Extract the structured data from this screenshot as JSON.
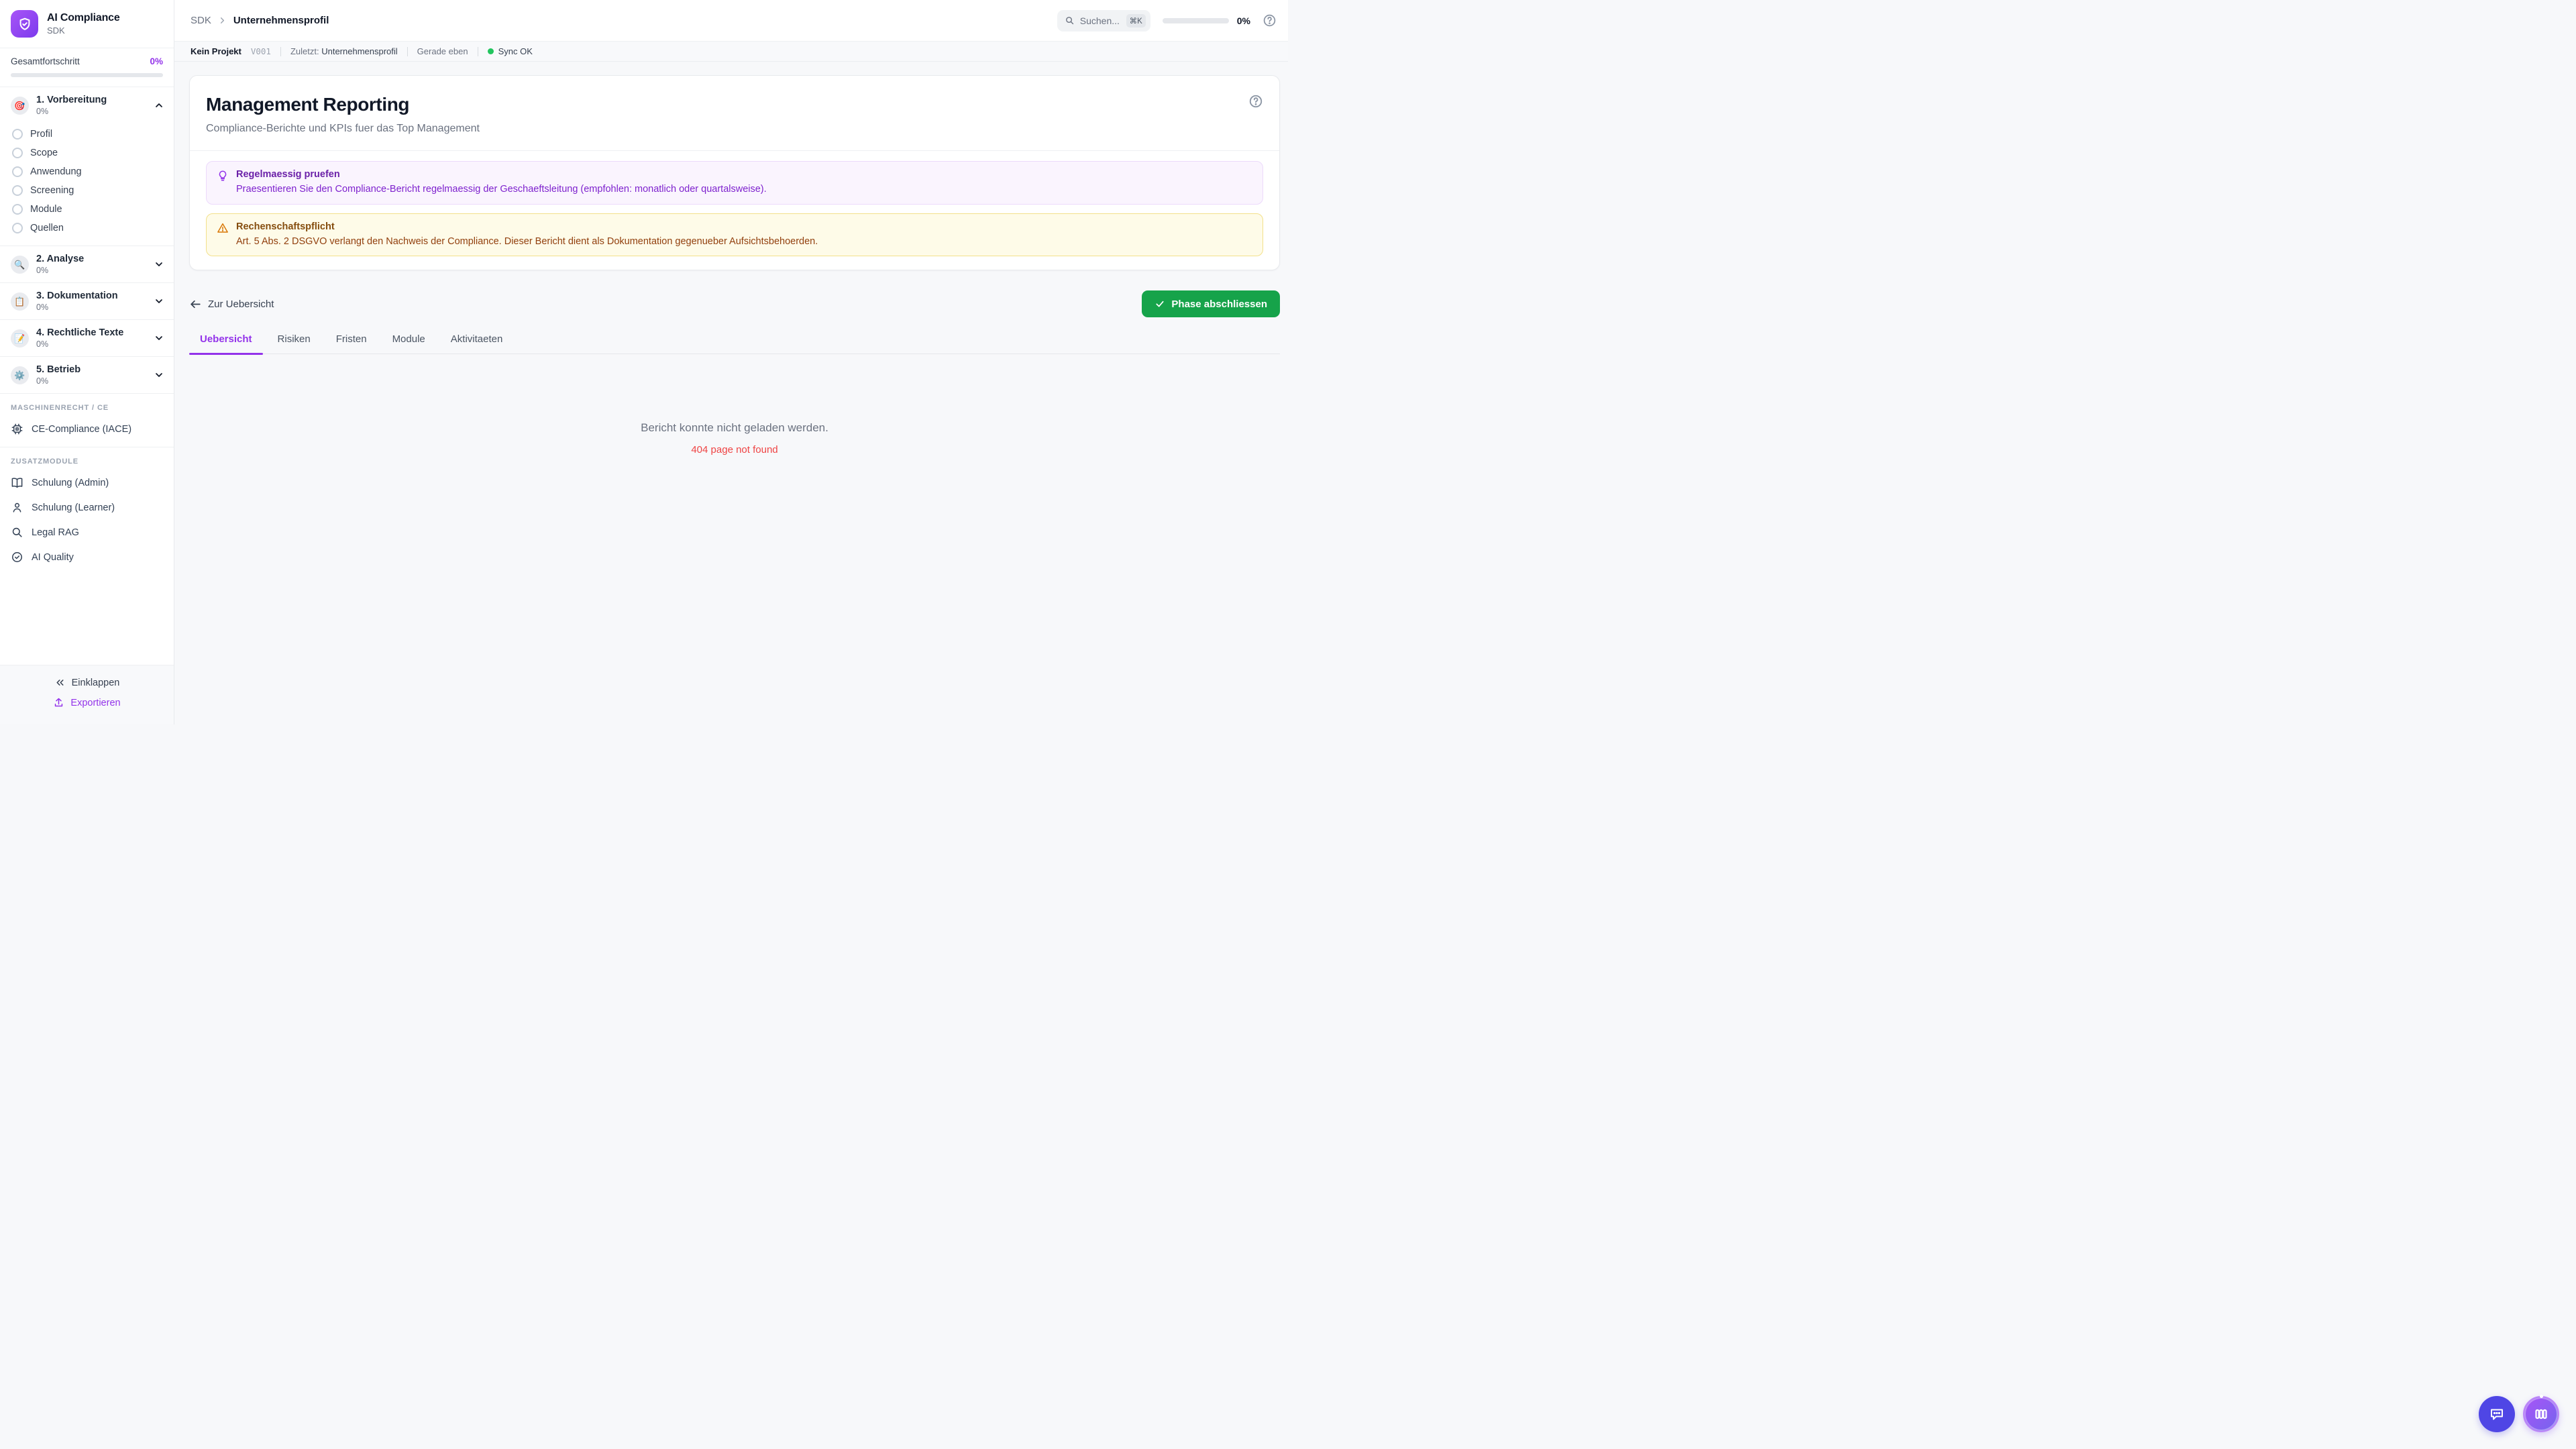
{
  "app": {
    "name": "AI Compliance",
    "subtitle": "SDK"
  },
  "sidebar": {
    "overall_progress": {
      "label": "Gesamtfortschritt",
      "value": "0%"
    },
    "phases": [
      {
        "icon": "🎯",
        "label": "1. Vorbereitung",
        "progress": "0%",
        "expanded": true,
        "subitems": [
          "Profil",
          "Scope",
          "Anwendung",
          "Screening",
          "Module",
          "Quellen"
        ]
      },
      {
        "icon": "🔍",
        "label": "2. Analyse",
        "progress": "0%",
        "expanded": false
      },
      {
        "icon": "📋",
        "label": "3. Dokumentation",
        "progress": "0%",
        "expanded": false
      },
      {
        "icon": "📝",
        "label": "4. Rechtliche Texte",
        "progress": "0%",
        "expanded": false
      },
      {
        "icon": "⚙️",
        "label": "5. Betrieb",
        "progress": "0%",
        "expanded": false
      }
    ],
    "sections": [
      {
        "label": "MASCHINENRECHT / CE",
        "items": [
          {
            "icon": "chip-icon",
            "label": "CE-Compliance (IACE)"
          }
        ]
      },
      {
        "label": "ZUSATZMODULE",
        "items": [
          {
            "icon": "book-icon",
            "label": "Schulung (Admin)"
          },
          {
            "icon": "user-icon",
            "label": "Schulung (Learner)"
          },
          {
            "icon": "search-icon",
            "label": "Legal RAG"
          },
          {
            "icon": "check-circle-icon",
            "label": "AI Quality"
          }
        ]
      }
    ],
    "footer": {
      "collapse": "Einklappen",
      "export": "Exportieren"
    }
  },
  "header": {
    "breadcrumb": {
      "root": "SDK",
      "current": "Unternehmensprofil"
    },
    "search": {
      "placeholder": "Suchen...",
      "shortcut": "⌘K"
    },
    "progress": "0%"
  },
  "statusbar": {
    "project": "Kein Projekt",
    "version": "V001",
    "last_label": "Zuletzt:",
    "last_value": "Unternehmensprofil",
    "time": "Gerade eben",
    "sync": "Sync OK"
  },
  "page": {
    "title": "Management Reporting",
    "subtitle": "Compliance-Berichte und KPIs fuer das Top Management",
    "hints": [
      {
        "type": "tip",
        "title": "Regelmaessig pruefen",
        "body": "Praesentieren Sie den Compliance-Bericht regelmaessig der Geschaeftsleitung (empfohlen: monatlich oder quartalsweise)."
      },
      {
        "type": "warning",
        "title": "Rechenschaftspflicht",
        "body": "Art. 5 Abs. 2 DSGVO verlangt den Nachweis der Compliance. Dieser Bericht dient als Dokumentation gegenueber Aufsichtsbehoerden."
      }
    ],
    "back_link": "Zur Uebersicht",
    "complete_button": "Phase abschliessen",
    "tabs": [
      "Uebersicht",
      "Risiken",
      "Fristen",
      "Module",
      "Aktivitaeten"
    ],
    "active_tab": "Uebersicht",
    "empty": {
      "message": "Bericht konnte nicht geladen werden.",
      "error": "404 page not found"
    }
  },
  "colors": {
    "accent": "#9333ea",
    "success_button": "#16a34a",
    "sync_dot": "#22c55e",
    "error_text": "#ef4444"
  }
}
